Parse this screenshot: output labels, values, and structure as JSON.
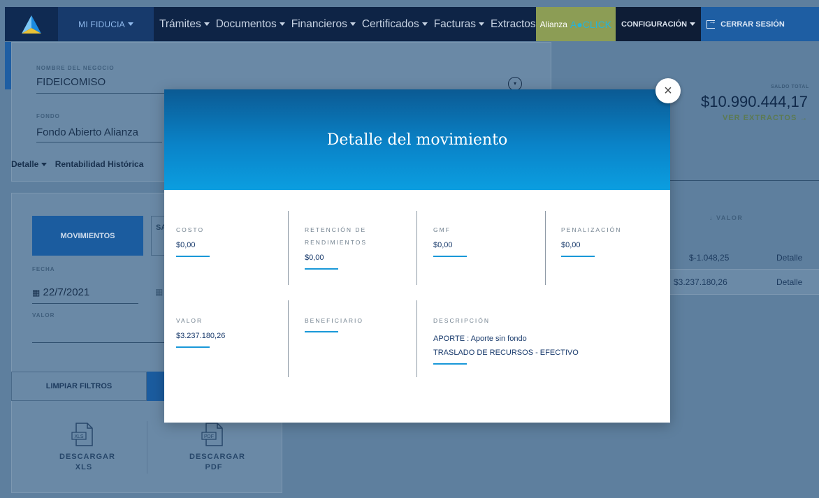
{
  "nav": {
    "mi_fiducia": "MI FIDUCIA",
    "menu": [
      "Trámites",
      "Documentos",
      "Financieros",
      "Certificados",
      "Facturas",
      "Extractos"
    ],
    "aoclick_prefix": "Alianza",
    "aoclick_brand": "A●CLICK",
    "config": "CONFIGURACIÓN",
    "logout": "CERRAR SESIÓN"
  },
  "negocio": {
    "label": "NOMBRE DEL NEGOCIO",
    "value": "FIDEICOMISO",
    "fondo_label": "FONDO",
    "fondo_value": "Fondo Abierto Alianza",
    "tabs": [
      "Detalle",
      "Rentabilidad Histórica"
    ]
  },
  "saldo": {
    "label": "SALDO TOTAL",
    "value": "$10.990.444,17",
    "link": "VER EXTRACTOS"
  },
  "filters": {
    "movimientos": "MOVIMIENTOS",
    "saldo_btn": "SA",
    "fecha_label": "FECHA",
    "fecha_value": "22/7/2021",
    "valor_label": "VALOR",
    "limpiar": "LIMPIAR FILTROS",
    "xls_label": "DESCARGAR XLS",
    "pdf_label": "DESCARGAR PDF",
    "xls_icon_text": "XLS",
    "pdf_icon_text": "PDF"
  },
  "table": {
    "valor_header": "VALOR",
    "rows": [
      {
        "valor": "$-1.048,25",
        "action": "Detalle"
      },
      {
        "valor": "$3.237.180,26",
        "action": "Detalle"
      }
    ]
  },
  "modal": {
    "title": "Detalle del movimiento",
    "close_label": "×",
    "costo": {
      "label": "COSTO",
      "value": "$0,00"
    },
    "retencion": {
      "label": "RETENCIÓN DE RENDIMIENTOS",
      "value": "$0,00"
    },
    "gmf": {
      "label": "GMF",
      "value": "$0,00"
    },
    "penalizacion": {
      "label": "PENALIZACIÓN",
      "value": "$0,00"
    },
    "valor": {
      "label": "VALOR",
      "value": "$3.237.180,26"
    },
    "beneficiario": {
      "label": "BENEFICIARIO",
      "value": ""
    },
    "descripcion": {
      "label": "DESCRIPCIÓN",
      "line1": "APORTE : Aporte sin fondo",
      "line2": "TRASLADO DE RECURSOS - EFECTIVO"
    }
  },
  "colors": {
    "accent": "#1998d8",
    "nav": "#0e2446",
    "overlay": "#5e7f9e"
  }
}
